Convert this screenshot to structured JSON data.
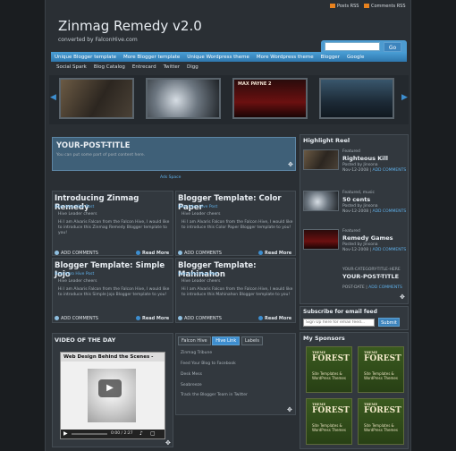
{
  "header": {
    "rss_posts": "Posts RSS",
    "rss_comments": "Comments RSS",
    "title": "Zinmag Remedy v2.0",
    "subtitle": "converted by FalconHive.com",
    "search_button": "Go"
  },
  "nav": {
    "main": [
      "Unique Blogger template",
      "More Blogger template",
      "Unique Wordpress theme",
      "More Wordpress theme",
      "Blogger",
      "Google"
    ],
    "sub": [
      "Social Spark",
      "Blog Catalog",
      "Entrecard",
      "Twitter",
      "Digg"
    ]
  },
  "slider": {
    "thumb3_text": "MAX PAYNE 2"
  },
  "featured": {
    "title": "YOUR-POST-TITLE",
    "text": "You can put some part of post content here.",
    "ad": "Ads Space"
  },
  "posts": [
    {
      "title": "Introducing Zinmag Remedy",
      "meta": "Hive Intro  Hive Post",
      "text1": "Hive Leader cheers",
      "text2": "Hi I am Alvaris Falcon from the Falcon Hive, I would like to introduce this Zinmag Remedy Blogger template to you!",
      "comments": "ADD COMMENTS",
      "readmore": "Read More"
    },
    {
      "title": "Blogger Template: Color Paper",
      "meta": "Hive Intro  Hive Post",
      "text1": "Hive Leader cheers",
      "text2": "Hi I am Alvaris Falcon from the Falcon Hive, I would like to introduce this Color Paper Blogger template to you!",
      "comments": "ADD COMMENTS",
      "readmore": "Read More"
    },
    {
      "title": "Blogger Template: Simple Jojo",
      "meta": "Hive Intro  Hive Post",
      "text1": "Hive Leader cheers",
      "text2": "Hi I am Alvaris Falcon from the Falcon Hive, I would like to introduce this Simple Jojo Blogger template to you!",
      "comments": "ADD COMMENTS",
      "readmore": "Read More"
    },
    {
      "title": "Blogger Template: Mahinahon",
      "meta": "Hive Intro  Hive Post",
      "text1": "Hive Leader cheers",
      "text2": "Hi I am Alvaris Falcon from the Falcon Hive, I would like to introduce this Mahinahon Blogger template to you!",
      "comments": "ADD COMMENTS",
      "readmore": "Read More"
    }
  ],
  "video": {
    "heading": "VIDEO OF THE DAY",
    "title": "Web Design Behind the Scenes -",
    "time": "0:00 / 2:27"
  },
  "tabs": {
    "labels": [
      "Falcon Hive",
      "Hive Link",
      "Labels"
    ],
    "links": [
      "Zinmag Tribune",
      "Feed Your Blog to Facebook",
      "Desk Mess",
      "Seabreeze",
      "Track the Blogger Team in Twitter"
    ]
  },
  "highlight": {
    "heading": "Highlight Reel",
    "items": [
      {
        "cat": "Featured",
        "title": "Righteous Kill",
        "author": "Posted by Jinsona",
        "date": "Nov-12-2008",
        "comments": "ADD COMMENTS"
      },
      {
        "cat": "Featured, music",
        "title": "50 cents",
        "author": "Posted by Jinsona",
        "date": "Nov-12-2008",
        "comments": "ADD COMMENTS"
      },
      {
        "cat": "Featured",
        "title": "Remedy Games",
        "author": "Posted by Jinsona",
        "date": "Nov-12-2008",
        "comments": "ADD COMMENTS"
      }
    ],
    "last_cat": "YOUR-CATEGORY-TITLE-HERE",
    "last_title": "YOUR-POST-TITLE",
    "last_date": "POST-DATE",
    "last_comments": "ADD COMMENTS"
  },
  "subscribe": {
    "heading": "Subscribe for email feed",
    "placeholder": "Sign Up here for email feed...",
    "button": "Submit"
  },
  "sponsors": {
    "heading": "My Sponsors",
    "logo_top": "THEME",
    "logo": "FOREST",
    "line1": "Site Templates &",
    "line2": "WordPress Themes"
  },
  "colors": {
    "accent": "#3d8ed0",
    "bg": "#1a1d20",
    "panel": "#32383e",
    "link": "#5fb0ea"
  }
}
